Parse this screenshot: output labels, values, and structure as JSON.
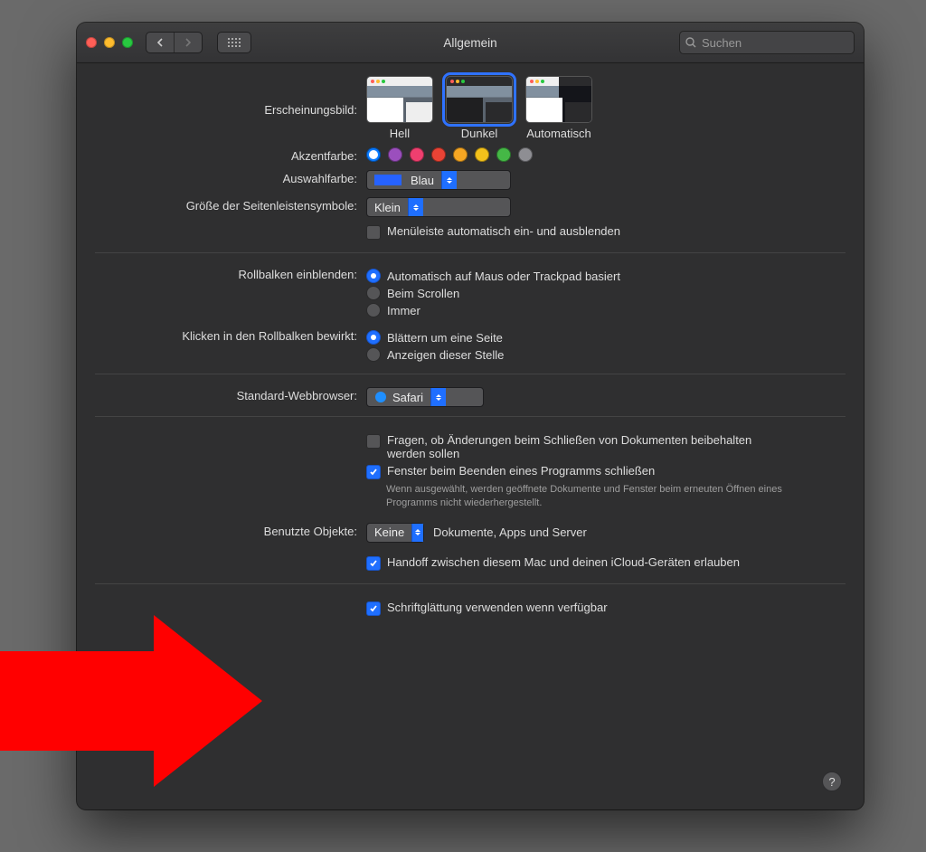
{
  "window_title": "Allgemein",
  "search_placeholder": "Suchen",
  "labels": {
    "appearance": "Erscheinungsbild:",
    "accent": "Akzentfarbe:",
    "highlight": "Auswahlfarbe:",
    "sidebar_size": "Größe der Seitenleistensymbole:",
    "scrollbars": "Rollbalken einblenden:",
    "click_scroll": "Klicken in den Rollbalken bewirkt:",
    "default_browser": "Standard-Webbrowser:",
    "recent_items": "Benutzte Objekte:"
  },
  "appearance_options": {
    "light": "Hell",
    "dark": "Dunkel",
    "auto": "Automatisch",
    "selected": "dark"
  },
  "accent_colors": {
    "options": [
      "#0a7bff",
      "#9b4fbd",
      "#ef3f6f",
      "#ea4335",
      "#f5a623",
      "#f3c11b",
      "#45b846",
      "#8e8e93"
    ],
    "selected_index": 0
  },
  "highlight": {
    "value": "Blau",
    "swatch": "#2662ff"
  },
  "sidebar_size": {
    "value": "Klein"
  },
  "menubar_autohide": {
    "label": "Menüleiste automatisch ein- und ausblenden",
    "checked": false
  },
  "scrollbar_radios": {
    "options": [
      "Automatisch auf Maus oder Trackpad basiert",
      "Beim Scrollen",
      "Immer"
    ],
    "selected_index": 0
  },
  "click_radios": {
    "options": [
      "Blättern um eine Seite",
      "Anzeigen dieser Stelle"
    ],
    "selected_index": 0
  },
  "default_browser": {
    "value": "Safari"
  },
  "docs": {
    "ask_keep_changes": {
      "label": "Fragen, ob Änderungen beim Schließen von Dokumenten beibehalten werden sollen",
      "checked": false
    },
    "close_windows": {
      "label": "Fenster beim Beenden eines Programms schließen",
      "checked": true
    },
    "close_windows_sub": "Wenn ausgewählt, werden geöffnete Dokumente und Fenster beim erneuten Öffnen eines Programms nicht wiederhergestellt."
  },
  "recent_items": {
    "value": "Keine",
    "suffix": "Dokumente, Apps und Server"
  },
  "handoff": {
    "label": "Handoff zwischen diesem Mac und deinen iCloud-Geräten erlauben",
    "checked": true
  },
  "font_smoothing": {
    "label": "Schriftglättung verwenden wenn verfügbar",
    "checked": true
  }
}
